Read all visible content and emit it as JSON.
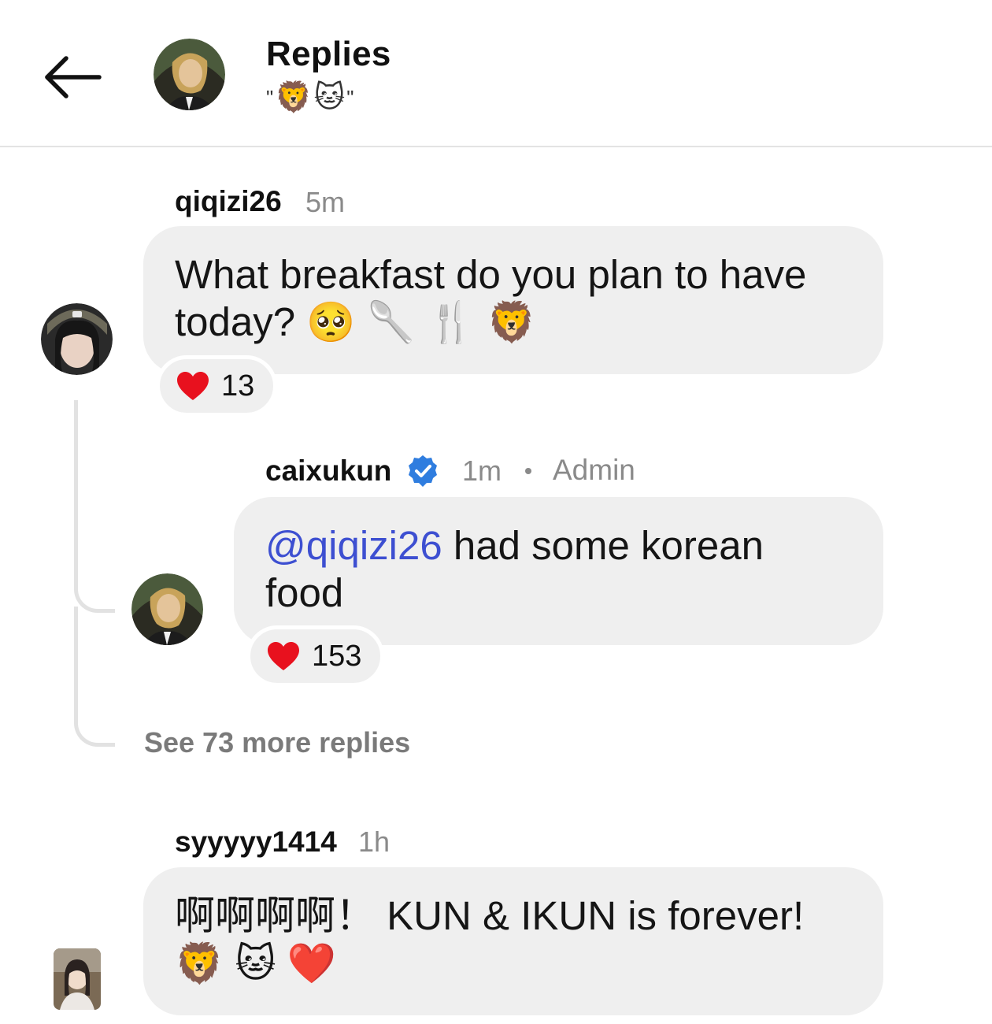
{
  "header": {
    "title": "Replies",
    "subtitle_quote_open": "\"",
    "subtitle_emojis": [
      "🦁",
      "🐱"
    ],
    "subtitle_quote_close": "\"",
    "back_icon": "arrow-left-icon"
  },
  "comments": [
    {
      "username": "qiqizi26",
      "time": "5m",
      "text": "What breakfast do you plan to have today?",
      "emojis": [
        "🥺",
        "🥄",
        "🍴",
        "🦁"
      ],
      "reaction_icon": "heart-icon",
      "reaction_count": "13"
    },
    {
      "username": "caixukun",
      "verified": true,
      "time": "1m",
      "role": "Admin",
      "mention": "@qiqizi26",
      "text": "had some korean food",
      "reaction_icon": "heart-icon",
      "reaction_count": "153"
    },
    {
      "username": "syyyyy1414",
      "time": "1h",
      "text": "啊啊啊啊！ KUN & IKUN is forever!",
      "emojis": [
        "🦁",
        "🐱",
        "❤️"
      ]
    }
  ],
  "see_more": "See 73 more replies",
  "colors": {
    "bubble": "#efefef",
    "mention": "#3d4fd1",
    "muted": "#8a8a8a",
    "verified": "#2f7ddf",
    "heart": "#e8111e"
  }
}
